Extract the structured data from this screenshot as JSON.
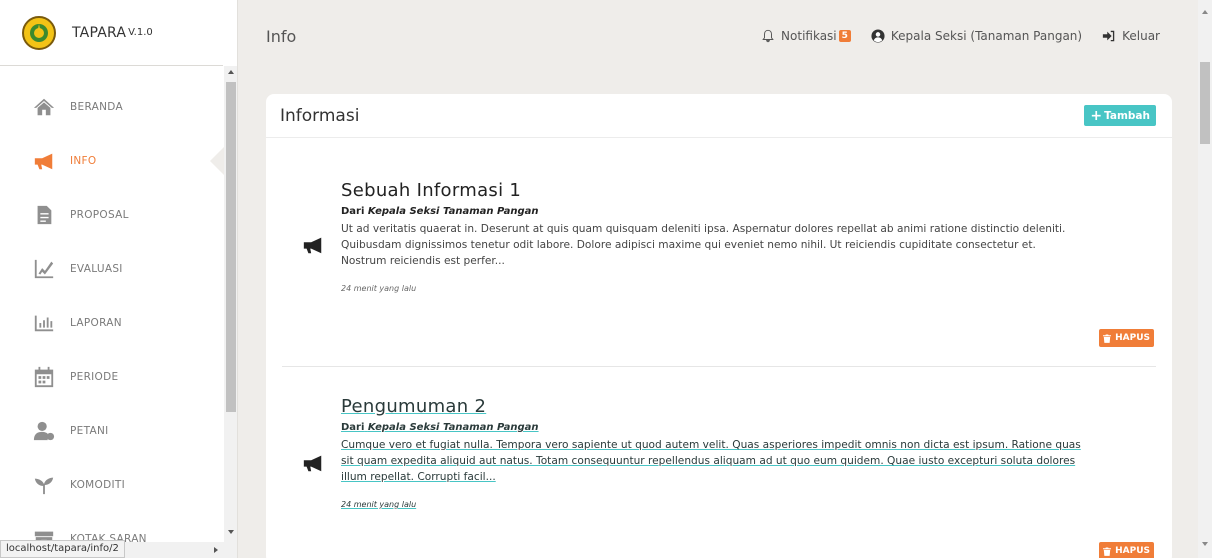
{
  "brand": {
    "name": "TAPARA",
    "version": "V.1.0"
  },
  "sidebar": {
    "items": [
      {
        "label": "BERANDA",
        "icon": "home-icon"
      },
      {
        "label": "INFO",
        "icon": "megaphone-icon",
        "active": true
      },
      {
        "label": "PROPOSAL",
        "icon": "document-icon"
      },
      {
        "label": "EVALUASI",
        "icon": "chart-pen-icon"
      },
      {
        "label": "LAPORAN",
        "icon": "bar-chart-icon"
      },
      {
        "label": "PERIODE",
        "icon": "calendar-icon"
      },
      {
        "label": "PETANI",
        "icon": "farmer-icon"
      },
      {
        "label": "KOMODITI",
        "icon": "sprout-icon"
      },
      {
        "label": "KOTAK SARAN",
        "icon": "inbox-icon"
      }
    ]
  },
  "status_url": "localhost/tapara/info/2",
  "header": {
    "title": "Info",
    "notification_label": "Notifikasi",
    "notification_count": "5",
    "user_label": "Kepala Seksi (Tanaman Pangan)",
    "logout_label": "Keluar"
  },
  "card": {
    "title": "Informasi",
    "add_label": "Tambah"
  },
  "posts": [
    {
      "title": "Sebuah Informasi 1",
      "from_prefix": "Dari",
      "author": "Kepala Seksi Tanaman Pangan",
      "body": "Ut ad veritatis quaerat in. Deserunt at quis quam quisquam deleniti ipsa. Aspernatur dolores repellat ab animi ratione distinctio deleniti. Quibusdam dignissimos tenetur odit labore. Dolore adipisci maxime qui eveniet nemo nihil. Ut reiciendis cupiditate consectetur et. Nostrum reiciendis est perfer...",
      "time": "24 menit yang lalu",
      "delete_label": "HAPUS"
    },
    {
      "title": "Pengumuman 2",
      "from_prefix": "Dari",
      "author": "Kepala Seksi Tanaman Pangan",
      "body": "Cumque vero et fugiat nulla. Tempora vero sapiente ut quod autem velit. Quas asperiores impedit omnis non dicta est ipsum. Ratione quas sit quam expedita aliquid aut natus. Totam consequuntur repellendus aliquam ad ut quo eum quidem. Quae iusto excepturi soluta dolores illum repellat. Corrupti facil...",
      "time": "24 menit yang lalu",
      "delete_label": "HAPUS"
    }
  ],
  "colors": {
    "accent": "#f07d38",
    "teal": "#48c5c5",
    "background": "#efedea"
  }
}
